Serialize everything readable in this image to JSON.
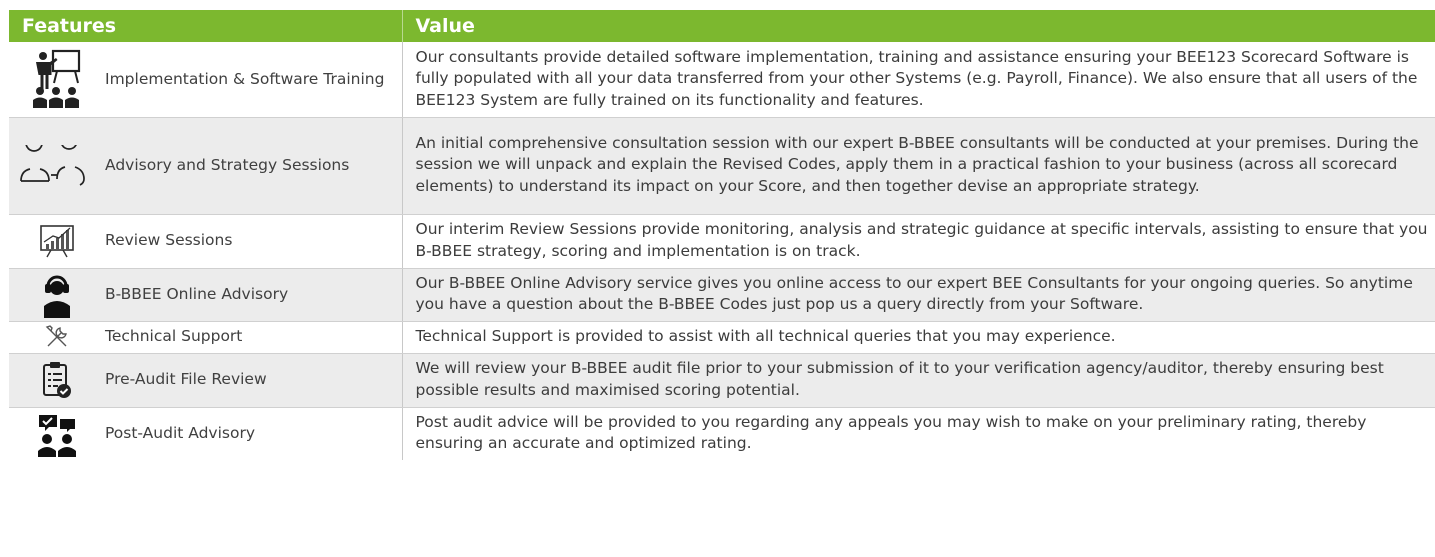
{
  "headers": {
    "features": "Features",
    "value": "Value"
  },
  "colors": {
    "header_bg": "#7cb82f",
    "header_text": "#ffffff",
    "alt_row": "#ececec"
  },
  "rows": [
    {
      "feature": "Implementation & Software Training",
      "icon": "presentation-trainer-icon",
      "value": "Our consultants provide detailed software implementation, training and assistance ensuring your BEE123 Scorecard Software is fully populated with all your data transferred from your other Systems (e.g. Payroll, Finance). We also ensure that all users of the BEE123 System are fully trained on its functionality and features."
    },
    {
      "feature": "Advisory and Strategy Sessions",
      "icon": "two-people-outline-icon",
      "value": "An initial comprehensive consultation session with our expert B-BBEE consultants will be conducted at your premises. During the session we will unpack and explain the Revised Codes, apply them in a practical fashion to your business (across all scorecard elements) to understand its impact on your Score, and then together devise an appropriate strategy."
    },
    {
      "feature": "Review Sessions",
      "icon": "growth-chart-board-icon",
      "value": "Our interim Review Sessions provide monitoring, analysis and strategic guidance at specific intervals, assisting to ensure that you B-BBEE strategy, scoring and implementation is on track."
    },
    {
      "feature": "B-BBEE Online Advisory",
      "icon": "headset-agent-icon",
      "value": "Our B-BBEE Online Advisory service gives you online access to our expert BEE Consultants for your ongoing queries. So anytime you have a question about the B-BBEE Codes just pop us a query directly from your Software."
    },
    {
      "feature": "Technical Support",
      "icon": "wrench-screwdriver-icon",
      "value": "Technical Support is provided to assist with all technical queries that you may experience."
    },
    {
      "feature": "Pre-Audit File Review",
      "icon": "clipboard-check-icon",
      "value": "We will review your B-BBEE audit file prior to your submission of it to your verification agency/auditor, thereby ensuring best possible results and maximised scoring potential."
    },
    {
      "feature": "Post-Audit Advisory",
      "icon": "people-speech-icon",
      "value": "Post audit advice will be provided to you regarding any appeals you may wish to make on your preliminary rating, thereby ensuring an accurate and optimized rating."
    }
  ]
}
